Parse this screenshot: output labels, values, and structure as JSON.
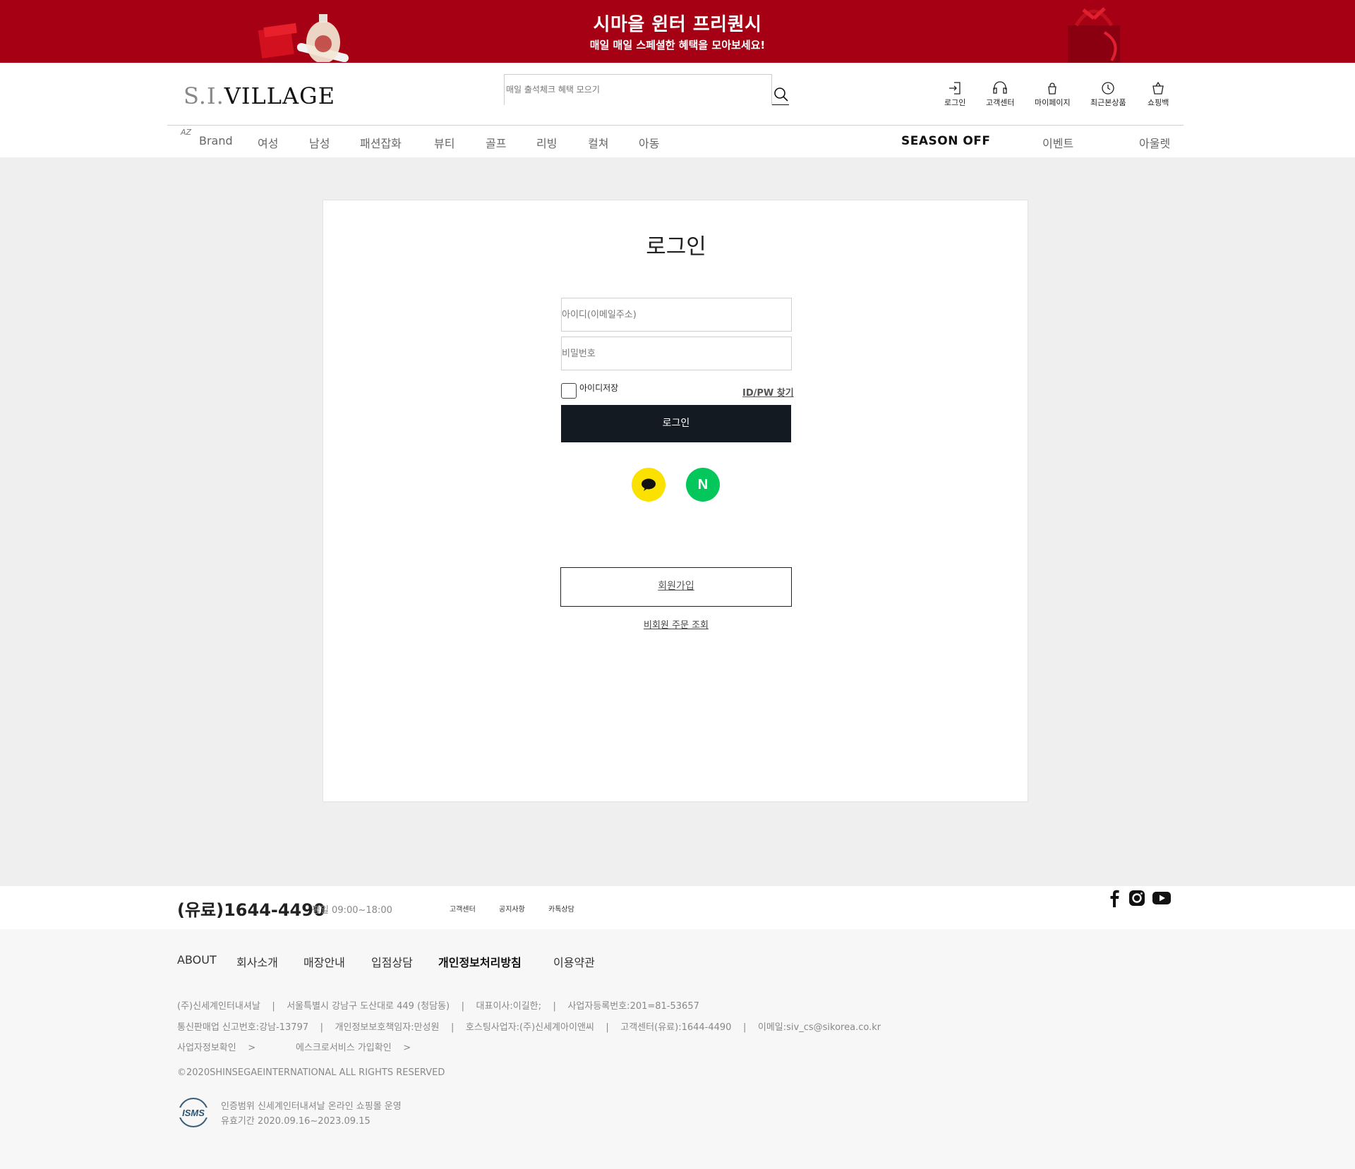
{
  "banner": {
    "title": "시마을 윈터 프리퀀시",
    "subtitle": "매일 매일 스페셜한 혜택을 모아보세요!",
    "color": "#a50014"
  },
  "header": {
    "logo_prefix": "S.I.",
    "logo_main": "VILLAGE",
    "search": {
      "placeholder": "매일 출석체크 혜택 모으기",
      "icon": "search-icon"
    },
    "utils": [
      {
        "label": "로그인",
        "icon": "login-icon"
      },
      {
        "label": "고객센터",
        "icon": "headset-icon"
      },
      {
        "label": "마이페이지",
        "icon": "mypage-icon"
      },
      {
        "label": "최근본상품",
        "icon": "clock-icon"
      },
      {
        "label": "쇼핑백",
        "icon": "shopping-bag-icon"
      }
    ],
    "az_label": "AZ",
    "gnb": [
      "Brand",
      "여성",
      "남성",
      "패션잡화",
      "뷰티",
      "골프",
      "리빙",
      "컬쳐",
      "아동"
    ],
    "gnb_right": [
      "SEASON OFF",
      "이벤트",
      "아울렛"
    ]
  },
  "login": {
    "title": "로그인",
    "id_placeholder": "아이디(이메일주소)",
    "pw_placeholder": "비밀번호",
    "save_id_label": "아이디저장",
    "find_label": "ID/PW 찾기",
    "login_button": "로그인",
    "sns": [
      {
        "name": "kakao",
        "icon": "kakao-icon",
        "color": "#fae100"
      },
      {
        "name": "naver",
        "icon": "naver-icon",
        "label": "N",
        "color": "#03c75a"
      }
    ],
    "join_button": "회원가입",
    "guest_order": "비회원 주문 조회",
    "button_color": "#141a22"
  },
  "footer": {
    "phone": "(유료)1644-4490",
    "hours": "평일 09:00~18:00",
    "links": [
      "고객센터",
      "공지사항",
      "카톡상담"
    ],
    "social": [
      "facebook-icon",
      "instagram-icon",
      "youtube-icon"
    ],
    "nav": [
      "ABOUT",
      "회사소개",
      "매장안내",
      "입점상담",
      "개인정보처리방침",
      "이용약관"
    ],
    "info_line1": "(주)신세계인터내셔날    |    서울특별시 강남구 도산대로 449 (청담동)    |    대표이사:이길한;    |    사업자등록번호:201=81-53657",
    "info_line2": "통신판매업 신고번호:강남-13797    |    개인정보보호책임자:만성원    |    호스팅사업자:(주)신세계아이앤씨    |    고객센터(유료):1644-4490    |    이메일:siv_cs@sikorea.co.kr",
    "biz_check": "사업자정보확인    >",
    "escrow_check": "에스크로서비스 가입확인    >",
    "copyright": "©2020SHINSEGAEINTERNATIONAL ALL RIGHTS RESERVED",
    "cert_scope": "인증범위 신세계인터내셔날 온라인 쇼핑몰 운영",
    "cert_period": "유효기간 2020.09.16~2023.09.15",
    "isms_label": "ISMS"
  }
}
